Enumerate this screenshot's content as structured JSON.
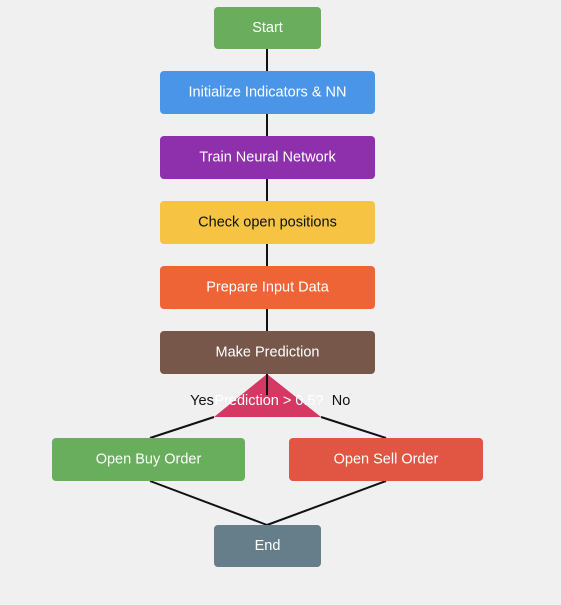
{
  "nodes": {
    "start": {
      "label": "Start",
      "color": "#6aae5d",
      "text_color": "#ffffff"
    },
    "init": {
      "label": "Initialize Indicators & NN",
      "color": "#4b95e9",
      "text_color": "#ffffff"
    },
    "train": {
      "label": "Train Neural Network",
      "color": "#8e30ab",
      "text_color": "#ffffff"
    },
    "check": {
      "label": "Check open positions",
      "color": "#f6c343",
      "text_color": "#111111"
    },
    "prepare": {
      "label": "Prepare Input Data",
      "color": "#ee6437",
      "text_color": "#ffffff"
    },
    "predict": {
      "label": "Make Prediction",
      "color": "#77574a",
      "text_color": "#ffffff"
    },
    "decision": {
      "label": "Prediction > 0.5?",
      "color": "#d63864",
      "text_color": "#ffffff"
    },
    "buy": {
      "label": "Open Buy Order",
      "color": "#69ae5c",
      "text_color": "#ffffff"
    },
    "sell": {
      "label": "Open Sell Order",
      "color": "#e15543",
      "text_color": "#ffffff"
    },
    "end": {
      "label": "End",
      "color": "#667d8a",
      "text_color": "#ffffff"
    }
  },
  "edges": {
    "yes_label": "Yes",
    "no_label": "No"
  }
}
